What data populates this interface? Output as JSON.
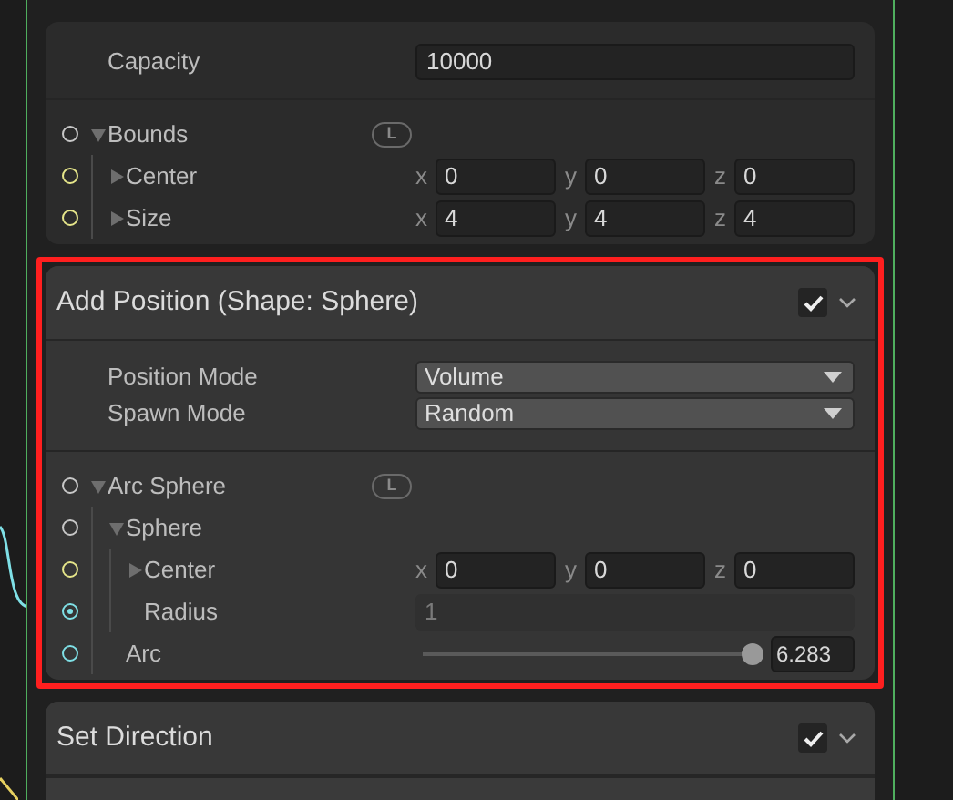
{
  "blocks": [
    {
      "kind": "properties",
      "selected": false,
      "rows": [
        {
          "kind": "number",
          "label": "Capacity",
          "value": "10000"
        }
      ],
      "tree": [
        {
          "kind": "group",
          "label": "Bounds",
          "badge": "L",
          "expanded": true,
          "port": {
            "color": "#c8c8c8",
            "connected": false
          },
          "children": [
            {
              "kind": "vector3",
              "label": "Center",
              "expanded": false,
              "port": {
                "color": "#e6e68a",
                "connected": false
              },
              "fields": [
                {
                  "axis": "x",
                  "value": "0"
                },
                {
                  "axis": "y",
                  "value": "0"
                },
                {
                  "axis": "z",
                  "value": "0"
                }
              ]
            },
            {
              "kind": "vector3",
              "label": "Size",
              "expanded": false,
              "port": {
                "color": "#e6e68a",
                "connected": false
              },
              "fields": [
                {
                  "axis": "x",
                  "value": "4"
                },
                {
                  "axis": "y",
                  "value": "4"
                },
                {
                  "axis": "z",
                  "value": "4"
                }
              ]
            }
          ]
        }
      ]
    },
    {
      "kind": "block",
      "title": "Add Position (Shape: Sphere)",
      "selected": true,
      "checked": true,
      "rows": [
        {
          "kind": "dropdown",
          "label": "Position Mode",
          "value": "Volume"
        },
        {
          "kind": "dropdown",
          "label": "Spawn Mode",
          "value": "Random"
        }
      ],
      "tree": [
        {
          "kind": "group",
          "label": "Arc Sphere",
          "badge": "L",
          "expanded": true,
          "port": {
            "color": "#c8c8c8",
            "connected": false
          },
          "children": [
            {
              "kind": "group",
              "label": "Sphere",
              "expanded": true,
              "port": {
                "color": "#c8c8c8",
                "connected": false
              },
              "children": [
                {
                  "kind": "vector3",
                  "label": "Center",
                  "expanded": false,
                  "port": {
                    "color": "#e6e68a",
                    "connected": false
                  },
                  "fields": [
                    {
                      "axis": "x",
                      "value": "0"
                    },
                    {
                      "axis": "y",
                      "value": "0"
                    },
                    {
                      "axis": "z",
                      "value": "0"
                    }
                  ]
                },
                {
                  "kind": "float",
                  "label": "Radius",
                  "disabled": true,
                  "value": "1",
                  "port": {
                    "color": "#7fe0e6",
                    "connected": true
                  }
                }
              ]
            },
            {
              "kind": "slider",
              "label": "Arc",
              "level": 1,
              "value": "6.283",
              "port": {
                "color": "#7fe0e6",
                "connected": false
              }
            }
          ]
        }
      ]
    },
    {
      "kind": "block",
      "title": "Set Direction",
      "selected": false,
      "checked": true
    }
  ]
}
